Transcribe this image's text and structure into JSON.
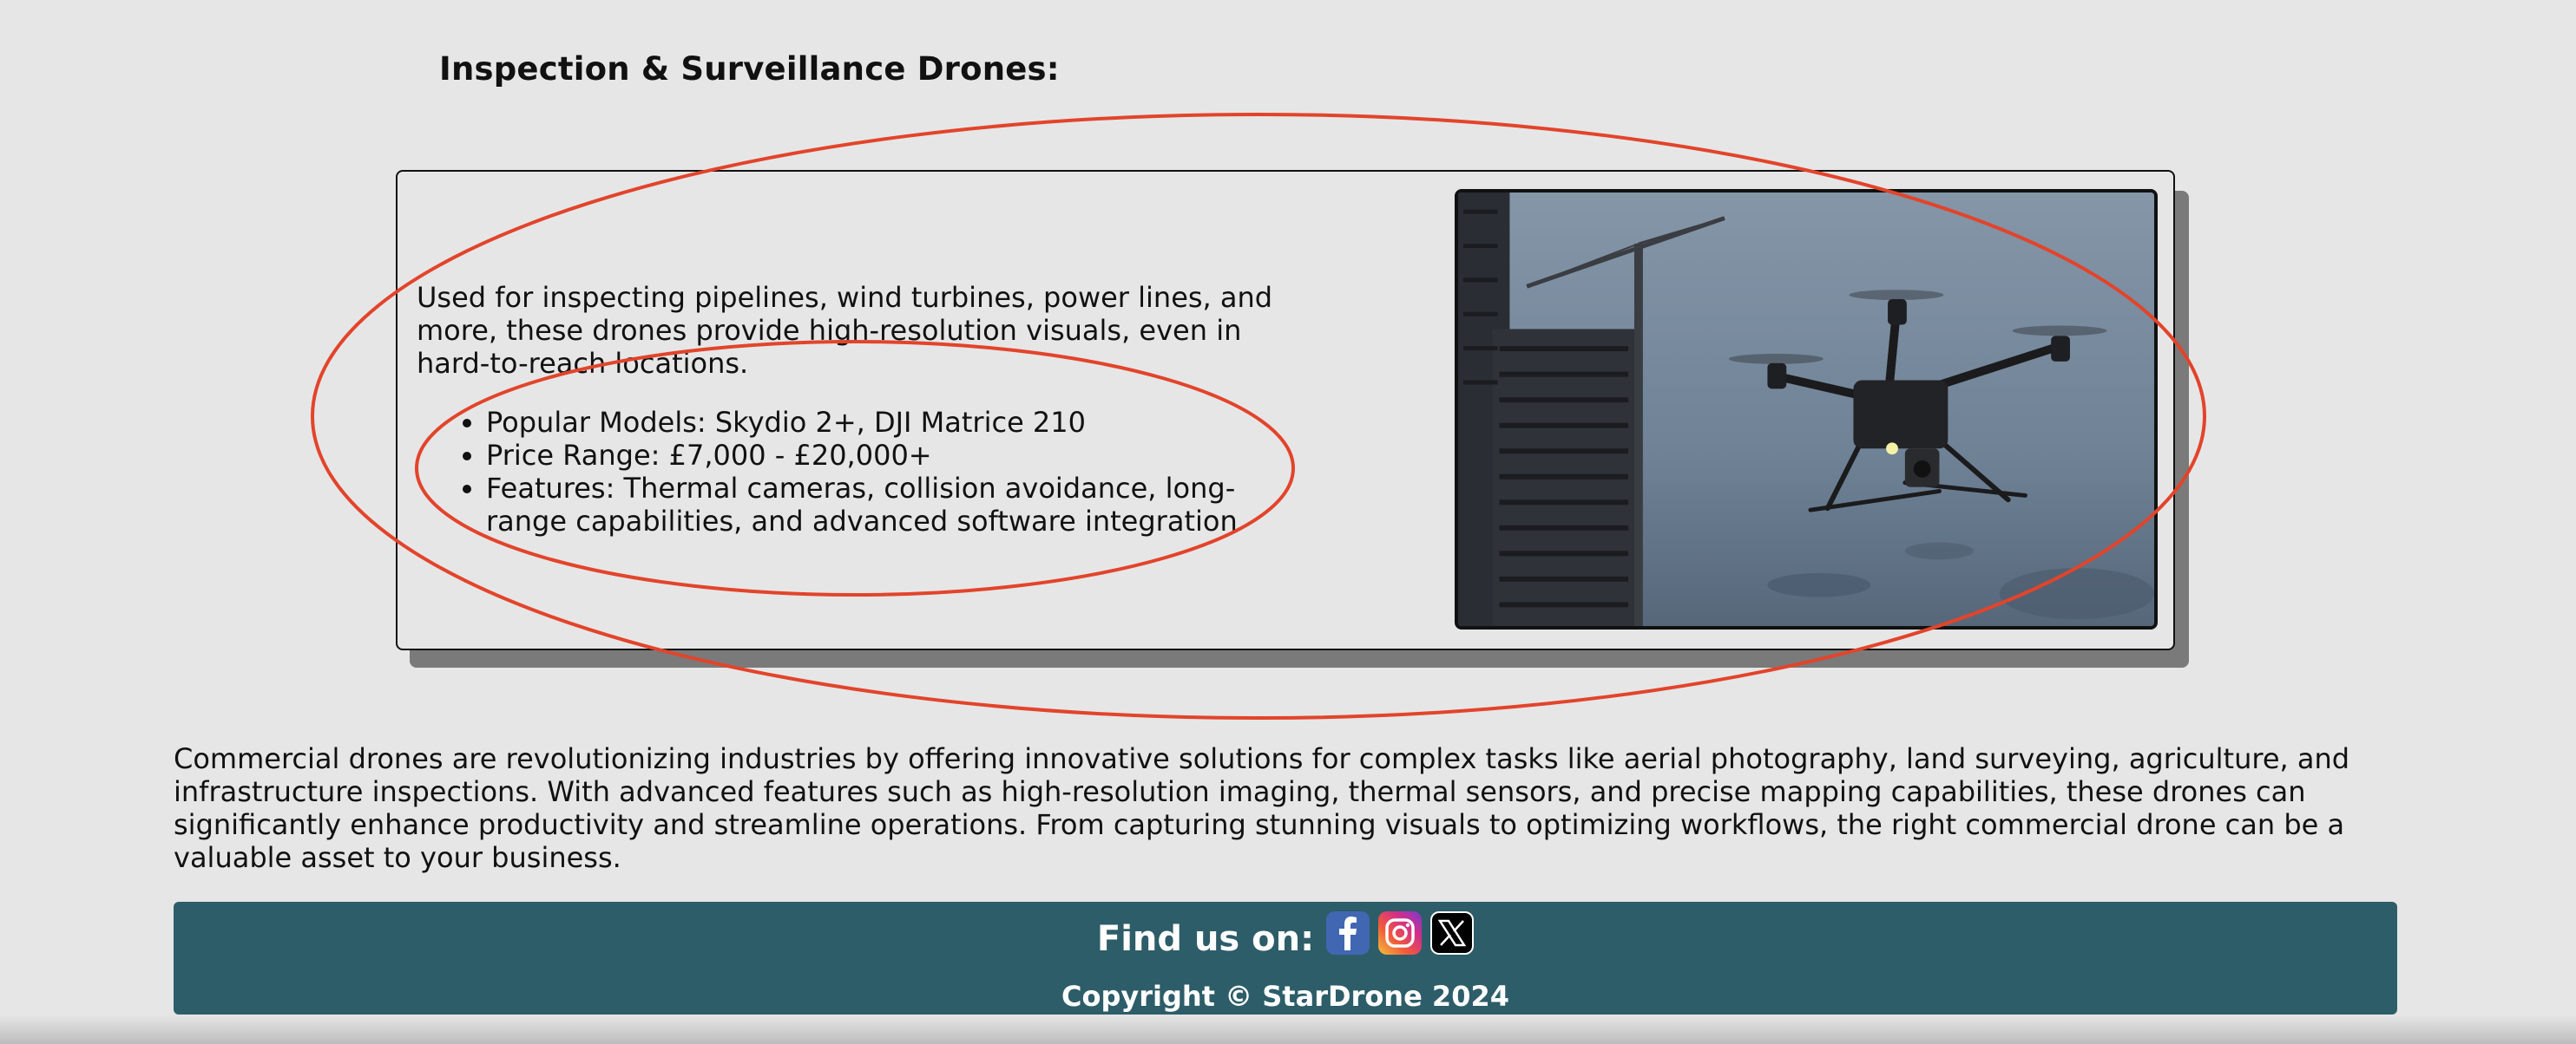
{
  "section": {
    "heading": "Inspection & Surveillance Drones:"
  },
  "card": {
    "description": "Used for inspecting pipelines, wind turbines, power lines, and more, these drones provide high-resolution visuals, even in hard-to-reach locations.",
    "bullets": [
      "Popular Models: Skydio 2+, DJI Matrice 210",
      "Price Range: £7,000 - £20,000+",
      "Features: Thermal cameras, collision avoidance, long-range capabilities, and advanced software integration"
    ],
    "image_subject": "drone-flying-near-building-under-construction"
  },
  "intro_paragraph": "Commercial drones are revolutionizing industries by offering innovative solutions for complex tasks like aerial photography, land surveying, agriculture, and infrastructure inspections. With advanced features such as high-resolution imaging, thermal sensors, and precise mapping capabilities, these drones can significantly enhance productivity and streamline operations. From capturing stunning visuals to optimizing workflows, the right commercial drone can be a valuable asset to your business.",
  "footer": {
    "find_label": "Find us on:",
    "socials": [
      {
        "name": "facebook",
        "icon": "facebook-icon",
        "glyph": "f"
      },
      {
        "name": "instagram",
        "icon": "instagram-icon",
        "glyph": ""
      },
      {
        "name": "x",
        "icon": "x-icon",
        "glyph": "X"
      }
    ],
    "copyright": "Copyright © StarDrone 2024"
  },
  "colors": {
    "background": "#e6e6e6",
    "footer": "#2d5d68",
    "annotation_red": "#e2442b"
  }
}
